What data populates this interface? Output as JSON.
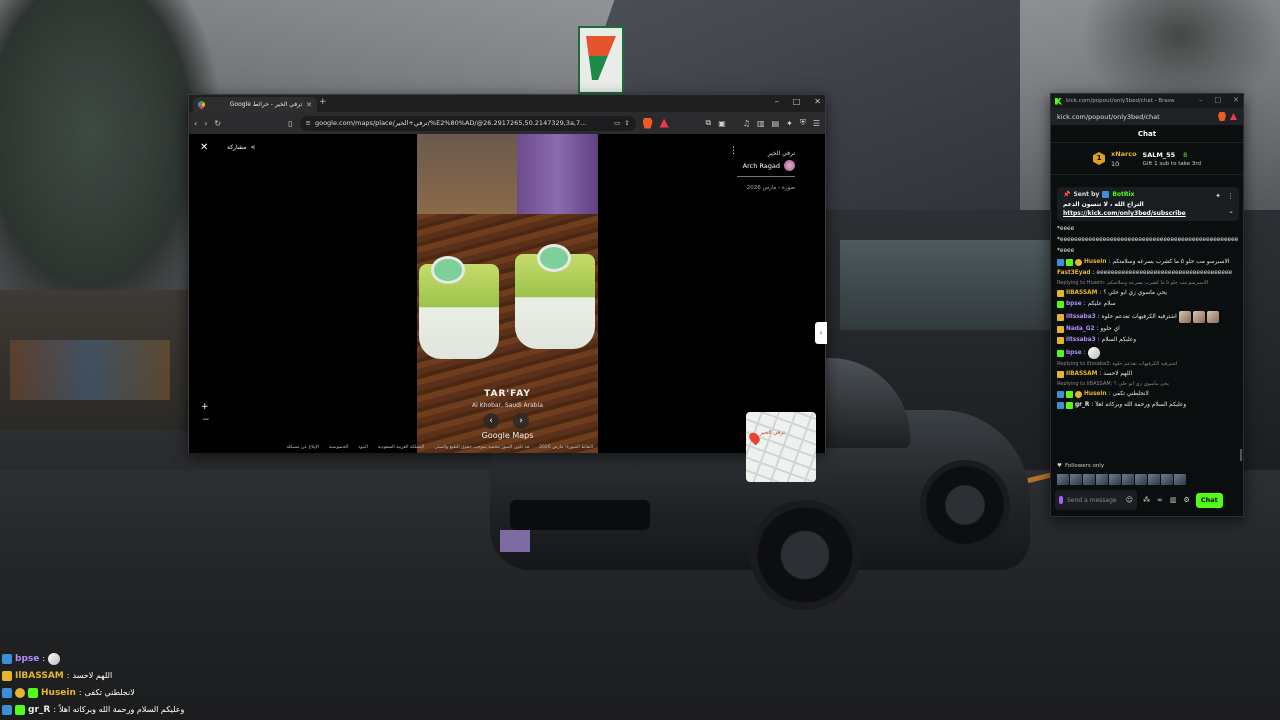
{
  "colors": {
    "kick_green": "#53fc18",
    "brave_orange": "#f15a24",
    "gold": "#e7b52d"
  },
  "browser_maps": {
    "tab_title": "ترفي الخير - خرائط Google",
    "url": "google.com/maps/place/ترفي+الخير/%E2%80%AD/@26.2917265,50.2147329,3a,7...",
    "share_label": "مشاركة",
    "place_title": "ترفي الخير",
    "author": "Arch Ragad",
    "date": "صورة - مارس 2026",
    "photo_caption": "TAR'FAY",
    "photo_location": "Al Khobar, Saudi Arabia",
    "watermark": "Google Maps",
    "minimap_label": "ترفي الخير",
    "footer_links": [
      "التقاط الصورة: مارس 2026",
      "قد تكون الصور محمية بموجب حقوق الطبع والنشر.",
      "المملكة العربية السعودية",
      "البنود",
      "الخصوصية",
      "الإبلاغ عن مشكلة"
    ]
  },
  "kick_window": {
    "title": "kick.com/popout/only3bed/chat - Brave",
    "url": "kick.com/popout/only3bed/chat",
    "header": "Chat",
    "leader": {
      "rank": "1",
      "name": "xNarco",
      "count": "10",
      "second_name": "SALM_55",
      "second_count": "8",
      "gift_text": "Gift 1 sub to take 3rd"
    },
    "pinned": {
      "sent_by": "Sent by",
      "sender": "BotRix",
      "message": "التراح الله ، لا تنسون الدعم",
      "link": "https://kick.com/only3bed/subscribe"
    },
    "messages": [
      {
        "kind": "text",
        "text": "*eeee"
      },
      {
        "kind": "text",
        "text": "*eeeeeeeeeeeeeeeeeeeeeeeeeeeeeeeeeeeeeeeeeeeeeeeeee"
      },
      {
        "kind": "text",
        "text": "*eeee"
      },
      {
        "kind": "msg",
        "name": "Husein",
        "color": "#e7b52d",
        "text": "الاسبرسو مب حلو ٥ ما كشرب بسرعه وسلامتكم"
      },
      {
        "kind": "msg",
        "name": "Fast3Eyad",
        "color": "#e7b52d",
        "text": "eeeeeeeeeeeeeeeeeeeeeeeeeeeeeeeeeeeeee"
      },
      {
        "kind": "reply",
        "text": "Replying to Husein: الاسبرسو مب حلو ٥ ما كشرب بسرعه وسلامتكم"
      },
      {
        "kind": "msg",
        "name": "IlBASSAM",
        "color": "#e7b52d",
        "text": "يحي ماسوي زي ابو حلي ؟"
      },
      {
        "kind": "msg",
        "name": "bpse",
        "color": "#b48cff",
        "text": "سلام عليكم"
      },
      {
        "kind": "msg",
        "name": "iltssaba3",
        "color": "#b48cff",
        "text": "اشترفيه الكرفيهات تعدعم حلوه"
      },
      {
        "kind": "msg",
        "name": "Nada_G2",
        "color": "#b48cff",
        "text": "اي حلوو"
      },
      {
        "kind": "msg",
        "name": "iltssaba3",
        "color": "#b48cff",
        "text": "وعليكم السلام"
      },
      {
        "kind": "msg",
        "name": "bpse",
        "color": "#b48cff",
        "text": ""
      },
      {
        "kind": "reply",
        "text": "Replying to iltssaba3: اشترفيه الكرفيهات تعدعم حلوه"
      },
      {
        "kind": "msg",
        "name": "IlBASSAM",
        "color": "#e7b52d",
        "text": "اللهم لاحسد"
      },
      {
        "kind": "reply",
        "text": "Replying to IlBASSAM: يحي ماسوي زي ابو حلي ؟"
      },
      {
        "kind": "msg",
        "name": "Husein",
        "color": "#e7b52d",
        "text": "لانجلطني تكفى"
      },
      {
        "kind": "msg",
        "name": "gr_R",
        "color": "#e8e8e8",
        "text": "وعليكم السلام ورحمة الله وبركاته اهلاً"
      }
    ],
    "followers_label": "Followers only",
    "input_placeholder": "Send a message",
    "chat_button": "Chat"
  },
  "overlay_chat": [
    {
      "name": "bpse",
      "color": "#b48cff",
      "text": ""
    },
    {
      "name": "IlBASSAM",
      "color": "#e7b52d",
      "text": "اللهم لاحسد"
    },
    {
      "name": "Husein",
      "color": "#e7b52d",
      "text": "لانجلطني تكفى"
    },
    {
      "name": "gr_R",
      "color": "#e8e8e8",
      "text": "وعليكم السلام ورحمة الله وبركاته اهلاً"
    }
  ]
}
